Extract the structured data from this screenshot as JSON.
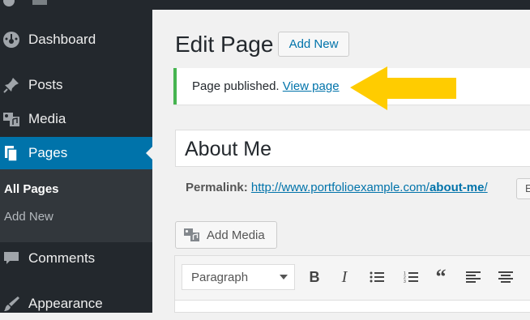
{
  "sidebar": {
    "items": [
      {
        "label": "Dashboard",
        "icon": "dashboard-icon"
      },
      {
        "label": "Posts",
        "icon": "pin-icon"
      },
      {
        "label": "Media",
        "icon": "media-icon"
      },
      {
        "label": "Pages",
        "icon": "pages-icon",
        "active": true
      },
      {
        "label": "Comments",
        "icon": "comment-icon"
      },
      {
        "label": "Appearance",
        "icon": "brush-icon"
      }
    ],
    "submenu": [
      {
        "label": "All Pages",
        "current": true
      },
      {
        "label": "Add New"
      }
    ]
  },
  "header": {
    "title": "Edit Page",
    "add_new": "Add New"
  },
  "notice": {
    "text": "Page published.",
    "link": "View page",
    "color": "#46b450"
  },
  "editor": {
    "title_value": "About Me",
    "permalink_label": "Permalink:",
    "permalink_base": "http://www.portfolioexample.com/",
    "permalink_slug": "about-me",
    "permalink_end": "/",
    "edit_label": "E",
    "add_media": "Add Media",
    "format_value": "Paragraph",
    "toolbar_buttons": [
      "bold-icon",
      "italic-icon",
      "bulleted-list-icon",
      "numbered-list-icon",
      "blockquote-icon",
      "align-left-icon",
      "align-center-icon"
    ]
  },
  "colors": {
    "accent": "#0073aa",
    "sidebar": "#23282d",
    "arrow": "#ffcc00"
  }
}
